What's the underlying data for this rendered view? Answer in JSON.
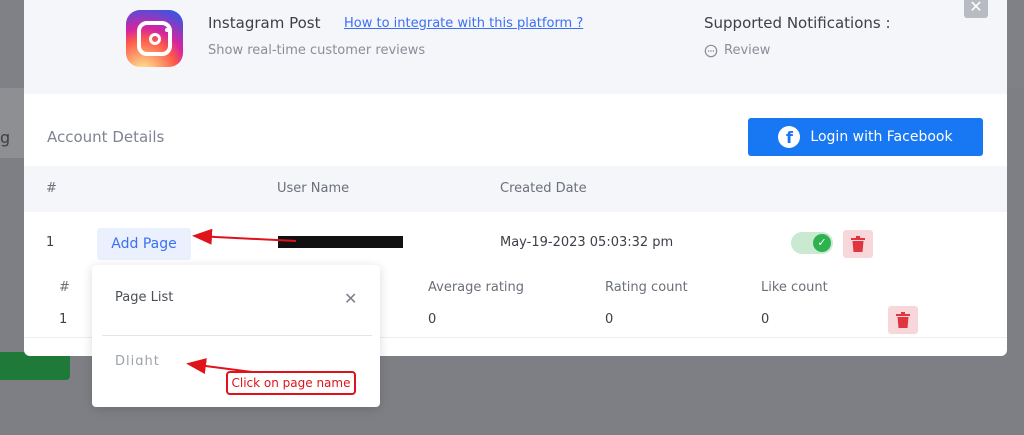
{
  "background": {
    "partial_tab_letter": "g"
  },
  "header": {
    "platform_title": "Instagram Post",
    "integrate_link": "How to integrate with this platform ?",
    "platform_desc": "Show real-time customer reviews",
    "supported_title": "Supported Notifications :",
    "supported_items": [
      "Review"
    ],
    "close_glyph": "✕"
  },
  "account": {
    "title": "Account Details",
    "fb_button_label": "Login with Facebook",
    "fb_icon_glyph": "f"
  },
  "table": {
    "headers": {
      "index": "#",
      "user_name": "User Name",
      "created_date": "Created Date"
    },
    "rows": [
      {
        "index": "1",
        "add_page_label": "Add Page",
        "created_date": "May-19-2023 05:03:32 pm",
        "enabled": true
      }
    ]
  },
  "sub_table": {
    "headers": {
      "index": "#",
      "average_rating": "Average rating",
      "rating_count": "Rating count",
      "like_count": "Like count"
    },
    "rows": [
      {
        "index": "1",
        "average_rating": "0",
        "rating_count": "0",
        "like_count": "0"
      }
    ]
  },
  "popover": {
    "title": "Page List",
    "close_glyph": "✕",
    "item_label": "Dlight"
  },
  "annotation": {
    "callout_text": "Click on page name",
    "color": "#e0121a"
  },
  "colors": {
    "facebook_blue": "#1877f2",
    "link_blue": "#3b6ff5",
    "toggle_green": "#2eb24f",
    "delete_red": "#e0353f"
  },
  "icons": {
    "logo": "instagram-logo-icon",
    "review": "chat-bubble-icon",
    "facebook": "facebook-icon",
    "toggle_check": "check-icon",
    "delete": "trash-icon"
  }
}
